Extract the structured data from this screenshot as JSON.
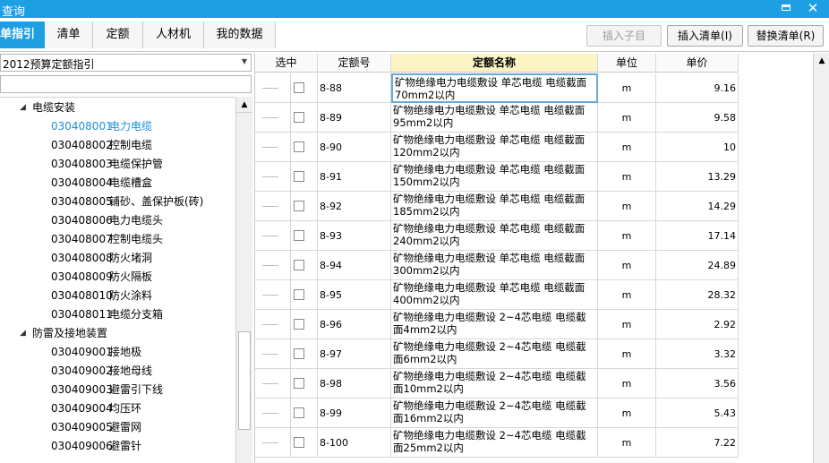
{
  "window": {
    "title": "查询",
    "minimize_icon": "minimize-icon",
    "close_icon": "close-icon",
    "close_glyph": "✕"
  },
  "tabs": [
    {
      "label": "单指引",
      "active": true
    },
    {
      "label": "清单",
      "active": false
    },
    {
      "label": "定额",
      "active": false
    },
    {
      "label": "人材机",
      "active": false
    },
    {
      "label": "我的数据",
      "active": false
    }
  ],
  "toolbar": {
    "insert_child": "插入子目",
    "insert_list": "插入清单(I)",
    "replace_list": "替换清单(R)"
  },
  "left": {
    "dropdown_value": "2012预算定额指引",
    "search_value": "",
    "tree": [
      {
        "type": "group",
        "label": "电缆安装"
      },
      {
        "type": "item",
        "code": "030408001",
        "name": "电力电缆",
        "selected": true
      },
      {
        "type": "item",
        "code": "030408002",
        "name": "控制电缆"
      },
      {
        "type": "item",
        "code": "030408003",
        "name": "电缆保护管"
      },
      {
        "type": "item",
        "code": "030408004",
        "name": "电缆槽盒"
      },
      {
        "type": "item",
        "code": "030408005",
        "name": "铺砂、盖保护板(砖)"
      },
      {
        "type": "item",
        "code": "030408006",
        "name": "电力电缆头"
      },
      {
        "type": "item",
        "code": "030408007",
        "name": "控制电缆头"
      },
      {
        "type": "item",
        "code": "030408008",
        "name": "防火堵洞"
      },
      {
        "type": "item",
        "code": "030408009",
        "name": "防火隔板"
      },
      {
        "type": "item",
        "code": "030408010",
        "name": "防火涂料"
      },
      {
        "type": "item",
        "code": "030408011",
        "name": "电缆分支箱"
      },
      {
        "type": "group",
        "label": "防雷及接地装置"
      },
      {
        "type": "item",
        "code": "030409001",
        "name": "接地极"
      },
      {
        "type": "item",
        "code": "030409002",
        "name": "接地母线"
      },
      {
        "type": "item",
        "code": "030409003",
        "name": "避雷引下线"
      },
      {
        "type": "item",
        "code": "030409004",
        "name": "均压环"
      },
      {
        "type": "item",
        "code": "030409005",
        "name": "避雷网"
      },
      {
        "type": "item",
        "code": "030409006",
        "name": "避雷针"
      }
    ]
  },
  "grid": {
    "headers": [
      "选中",
      "定额号",
      "定额名称",
      "单位",
      "单价"
    ],
    "rows": [
      {
        "code": "8-88",
        "name": "矿物绝缘电力电缆敷设 单芯电缆 电缆截面70mm2以内",
        "unit": "m",
        "price": "9.16"
      },
      {
        "code": "8-89",
        "name": "矿物绝缘电力电缆敷设 单芯电缆 电缆截面95mm2以内",
        "unit": "m",
        "price": "9.58"
      },
      {
        "code": "8-90",
        "name": "矿物绝缘电力电缆敷设 单芯电缆 电缆截面120mm2以内",
        "unit": "m",
        "price": "10"
      },
      {
        "code": "8-91",
        "name": "矿物绝缘电力电缆敷设 单芯电缆 电缆截面150mm2以内",
        "unit": "m",
        "price": "13.29"
      },
      {
        "code": "8-92",
        "name": "矿物绝缘电力电缆敷设 单芯电缆 电缆截面185mm2以内",
        "unit": "m",
        "price": "14.29"
      },
      {
        "code": "8-93",
        "name": "矿物绝缘电力电缆敷设 单芯电缆 电缆截面240mm2以内",
        "unit": "m",
        "price": "17.14"
      },
      {
        "code": "8-94",
        "name": "矿物绝缘电力电缆敷设 单芯电缆 电缆截面300mm2以内",
        "unit": "m",
        "price": "24.89"
      },
      {
        "code": "8-95",
        "name": "矿物绝缘电力电缆敷设 单芯电缆 电缆截面400mm2以内",
        "unit": "m",
        "price": "28.32"
      },
      {
        "code": "8-96",
        "name": "矿物绝缘电力电缆敷设 2~4芯电缆 电缆截面4mm2以内",
        "unit": "m",
        "price": "2.92"
      },
      {
        "code": "8-97",
        "name": "矿物绝缘电力电缆敷设 2~4芯电缆 电缆截面6mm2以内",
        "unit": "m",
        "price": "3.32"
      },
      {
        "code": "8-98",
        "name": "矿物绝缘电力电缆敷设 2~4芯电缆 电缆截面10mm2以内",
        "unit": "m",
        "price": "3.56"
      },
      {
        "code": "8-99",
        "name": "矿物绝缘电力电缆敷设 2~4芯电缆 电缆截面16mm2以内",
        "unit": "m",
        "price": "5.43"
      },
      {
        "code": "8-100",
        "name": "矿物绝缘电力电缆敷设 2~4芯电缆 电缆截面25mm2以内",
        "unit": "m",
        "price": "7.22"
      }
    ]
  },
  "colors": {
    "accent": "#1e9ee3",
    "selected_text": "#1e8fd8",
    "sorted_header": "#fdf4c4"
  },
  "icons": {
    "tree_expanded": "triangle-down-icon",
    "scroll_up": "scroll-up-icon",
    "dropdown": "chevron-down-icon"
  }
}
